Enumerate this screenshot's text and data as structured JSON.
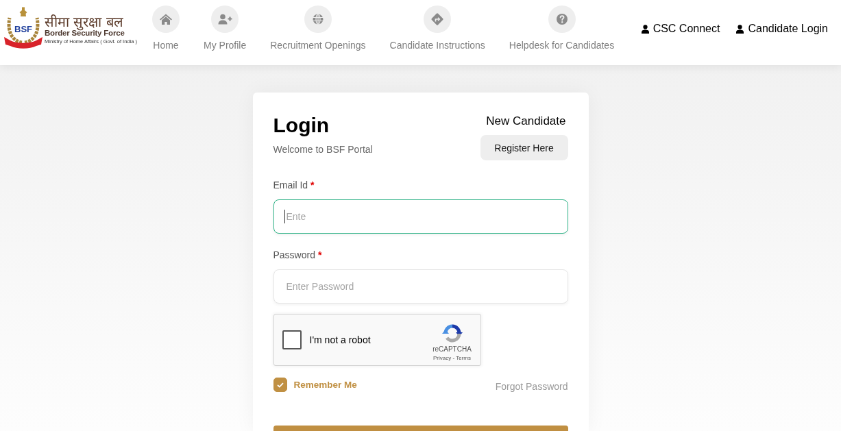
{
  "header": {
    "logo": {
      "emblem_label": "BSF",
      "hindi_name": "सीमा सुरक्षा बल",
      "name": "Border Security Force",
      "ministry": "Ministry of Home Affairs ( Govt. of India )"
    },
    "nav": [
      {
        "label": "Home"
      },
      {
        "label": "My Profile"
      },
      {
        "label": "Recruitment Openings"
      },
      {
        "label": "Candidate Instructions"
      },
      {
        "label": "Helpdesk for Candidates"
      }
    ],
    "account_links": [
      {
        "label": "CSC Connect"
      },
      {
        "label": "Candidate Login"
      }
    ]
  },
  "login_card": {
    "title": "Login",
    "subtitle": "Welcome to BSF Portal",
    "new_candidate": {
      "heading": "New Candidate",
      "button": "Register Here"
    },
    "fields": [
      {
        "label": "Email Id",
        "required_mark": "*",
        "placeholder": "Ente",
        "focused": true
      },
      {
        "label": "Password",
        "required_mark": "*",
        "placeholder": "Enter Password",
        "focused": false
      }
    ],
    "captcha": {
      "label": "I'm not a robot",
      "checked": false,
      "brand": "reCAPTCHA",
      "links": "Privacy - Terms"
    },
    "remember_me": {
      "label": "Remember Me",
      "checked": true
    },
    "forgot_password": "Forgot Password"
  }
}
